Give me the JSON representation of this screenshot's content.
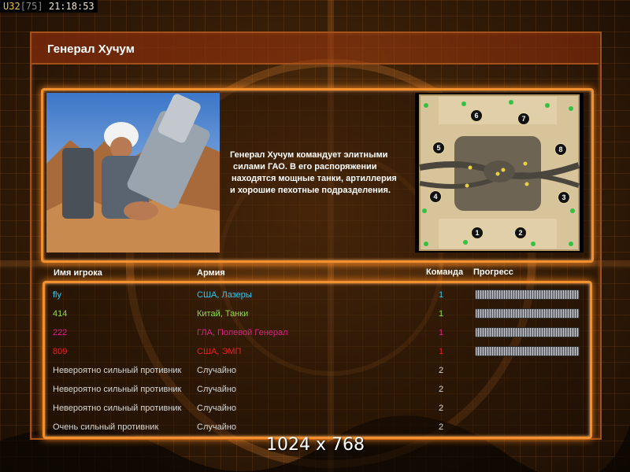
{
  "status": {
    "u_label": "U",
    "count": "32",
    "max": "75",
    "time": "21:18:53"
  },
  "title": "Генерал Хучум",
  "description": "Генерал Хучум командует элитными силами ГАО. В его распоряжении находятся мощные танки, артиллерия и хорошие пехотные подразделения.",
  "description_lines": [
    "Генерал Хучум командует элитными",
    "силами ГАО. В его распоряжении",
    "находятся мощные танки, артиллерия",
    "и хорошие пехотные подразделения."
  ],
  "map": {
    "start_positions": [
      "1",
      "2",
      "3",
      "4",
      "5",
      "6",
      "7",
      "8"
    ]
  },
  "table": {
    "headers": {
      "name": "Имя игрока",
      "army": "Армия",
      "team": "Команда",
      "progress": "Прогресс"
    },
    "rows": [
      {
        "name": "fly",
        "army": "США, Лазеры",
        "team": "1",
        "color": "#33c8f0",
        "progress": 1
      },
      {
        "name": "414",
        "army": "Китай, Танки",
        "team": "1",
        "color": "#8ce040",
        "progress": 1
      },
      {
        "name": "222",
        "army": "ГЛА, Полевой Генерал",
        "team": "1",
        "color": "#e0208a",
        "progress": 1
      },
      {
        "name": "809",
        "army": "США, ЭМП",
        "team": "1",
        "color": "#e82020",
        "progress": 1
      },
      {
        "name": "Невероятно сильный противник",
        "army": "Случайно",
        "team": "2",
        "color": "#d8d8d8"
      },
      {
        "name": "Невероятно сильный противник",
        "army": "Случайно",
        "team": "2",
        "color": "#d8d8d8"
      },
      {
        "name": "Невероятно сильный противник",
        "army": "Случайно",
        "team": "2",
        "color": "#d8d8d8"
      },
      {
        "name": "Очень сильный противник",
        "army": "Случайно",
        "team": "2",
        "color": "#d8d8d8"
      }
    ]
  },
  "resolution": "1024 x 768"
}
